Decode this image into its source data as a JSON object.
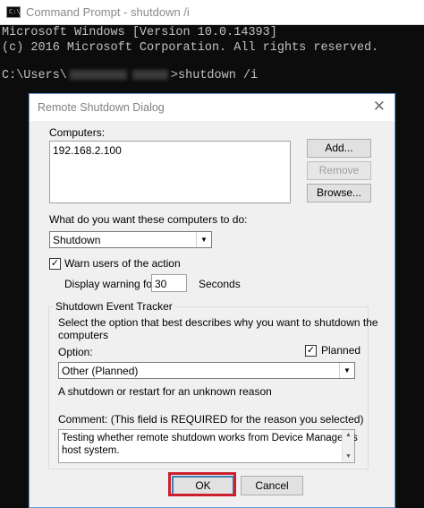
{
  "console": {
    "window_title": "Command Prompt - shutdown  /i",
    "icon_text": "C:\\",
    "line1": "Microsoft Windows [Version 10.0.14393]",
    "line2": "(c) 2016 Microsoft Corporation. All rights reserved.",
    "prompt_prefix": "C:\\Users\\",
    "prompt_suffix": ">shutdown /i"
  },
  "dialog": {
    "title": "Remote Shutdown Dialog",
    "close_glyph": "✕",
    "computers_label": "Computers:",
    "computers": [
      "192.168.2.100"
    ],
    "add_button": "Add...",
    "remove_button": "Remove",
    "browse_button": "Browse...",
    "action_label": "What do you want these computers to do:",
    "action_value": "Shutdown",
    "warn_label": "Warn users of the action",
    "warn_checked": true,
    "display_warning_label": "Display warning for",
    "display_warning_value": "30",
    "seconds_label": "Seconds",
    "tracker": {
      "legend": "Shutdown Event Tracker",
      "description_line1": "Select the option that best describes why you want to shutdown the",
      "description_line2": "computers",
      "option_label": "Option:",
      "planned_label": "Planned",
      "planned_checked": true,
      "option_value": "Other (Planned)",
      "option_description": "A shutdown or restart for an unknown reason",
      "comment_label": "Comment:",
      "comment_hint": " (This field is REQUIRED for the reason you selected)",
      "comment_line1": "Testing whether remote shutdown works from Device ManageR's",
      "comment_line2": "host system."
    },
    "ok_button": "OK",
    "cancel_button": "Cancel"
  },
  "icons": {
    "check": "✓",
    "dropdown_arrow": "▼",
    "scroll_up": "▲",
    "scroll_down": "▼"
  },
  "colors": {
    "console_bg": "#0c0c0c",
    "console_text": "#c0c0c0",
    "highlight": "#cc1f2e",
    "dialog_border": "#6f9ad6"
  }
}
